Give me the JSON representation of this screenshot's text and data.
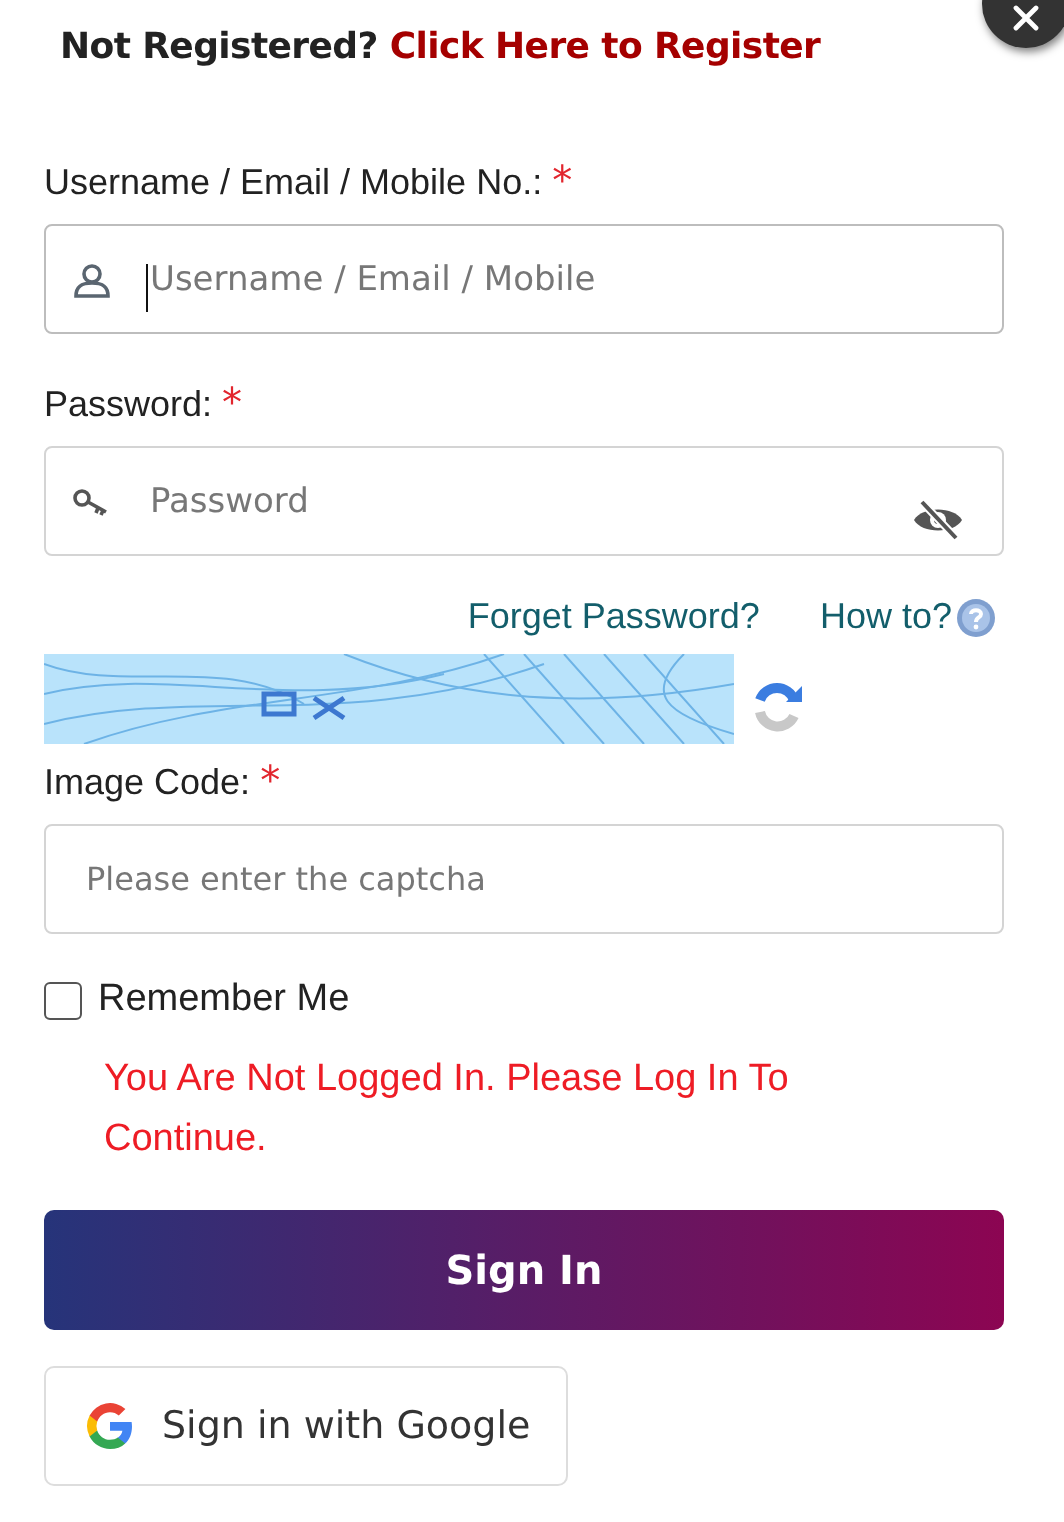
{
  "header": {
    "prompt": "Not Registered?",
    "link": "Click Here to Register"
  },
  "fields": [
    {
      "kind": "username",
      "label": "Username / Email / Mobile No.:",
      "required_mark": "*",
      "placeholder": "Username / Email / Mobile",
      "focused": true
    },
    {
      "kind": "password",
      "label": "Password:",
      "required_mark": "*",
      "placeholder": "Password",
      "focused": false
    }
  ],
  "links": {
    "forgot": "Forget Password?",
    "howto": "How to?"
  },
  "captcha": {
    "kind": "picture",
    "label": "Image Code:",
    "required_mark": "*",
    "placeholder": "Please enter the captcha"
  },
  "remember": {
    "label": "Remember Me",
    "checked": false
  },
  "error": "You Are Not Logged In. Please Log In To Continue.",
  "sign_in": "Sign In",
  "google": "Sign in with Google"
}
